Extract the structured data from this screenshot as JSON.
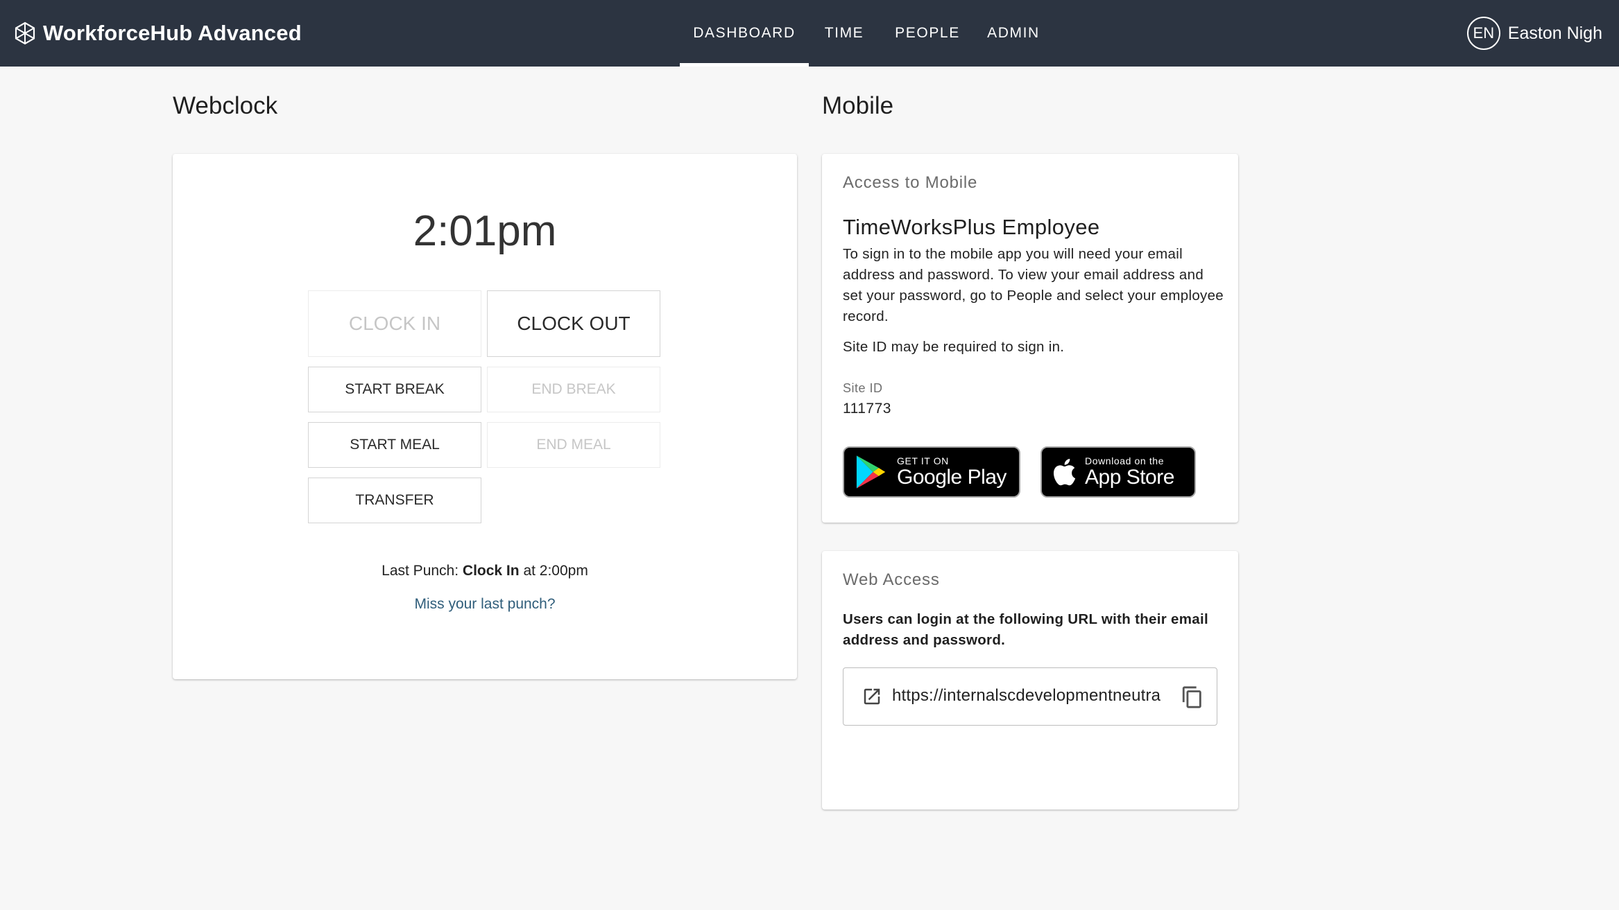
{
  "header": {
    "brand": "WorkforceHub Advanced",
    "nav": [
      {
        "label": "DASHBOARD",
        "active": true
      },
      {
        "label": "TIME",
        "active": false
      },
      {
        "label": "PEOPLE",
        "active": false
      },
      {
        "label": "ADMIN",
        "active": false
      }
    ],
    "user": {
      "initials": "EN",
      "name": "Easton Nigh"
    },
    "bg_color": "#2c3441"
  },
  "webclock": {
    "title": "Webclock",
    "time": "2:01pm",
    "buttons": {
      "clock_in": {
        "label": "CLOCK IN",
        "enabled": false
      },
      "clock_out": {
        "label": "CLOCK OUT",
        "enabled": true
      },
      "start_break": {
        "label": "START BREAK",
        "enabled": true
      },
      "end_break": {
        "label": "END BREAK",
        "enabled": false
      },
      "start_meal": {
        "label": "START MEAL",
        "enabled": true
      },
      "end_meal": {
        "label": "END MEAL",
        "enabled": false
      },
      "transfer": {
        "label": "TRANSFER",
        "enabled": true
      }
    },
    "last_punch": {
      "prefix": "Last Punch:",
      "type": "Clock In",
      "connector": "at",
      "time": "2:00pm"
    },
    "miss_link": "Miss your last punch?"
  },
  "mobile": {
    "title": "Mobile",
    "card_label": "Access to Mobile",
    "app_name": "TimeWorksPlus Employee",
    "description": "To sign in to the mobile app you will need your email address and password. To view your email address and set your password, go to People and select your employee record.",
    "site_note": "Site ID may be required to sign in.",
    "site_id_label": "Site ID",
    "site_id_value": "111773",
    "google_play": {
      "small": "GET IT ON",
      "large": "Google Play"
    },
    "app_store": {
      "small": "Download on the",
      "large": "App Store"
    }
  },
  "web_access": {
    "card_label": "Web Access",
    "description": "Users can login at the following URL with their email address and password.",
    "url": "https://internalscdevelopmentneutra",
    "link_color": "#2f5d7a"
  }
}
